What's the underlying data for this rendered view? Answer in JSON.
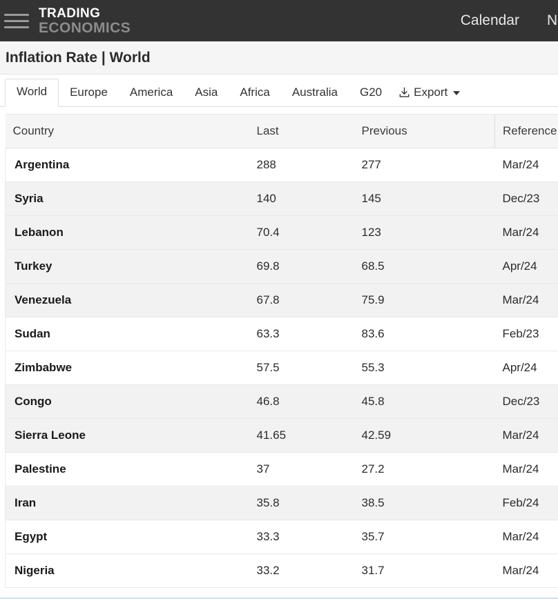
{
  "topbar": {
    "menu_icon": "hamburger-menu-icon",
    "brand_line1": "TRADING",
    "brand_line2": "ECONOMICS",
    "nav": [
      {
        "label": "Calendar"
      },
      {
        "label": "New"
      }
    ]
  },
  "page": {
    "title": "Inflation Rate | World"
  },
  "tabs": [
    {
      "label": "World",
      "active": true
    },
    {
      "label": "Europe",
      "active": false
    },
    {
      "label": "America",
      "active": false
    },
    {
      "label": "Asia",
      "active": false
    },
    {
      "label": "Africa",
      "active": false
    },
    {
      "label": "Australia",
      "active": false
    },
    {
      "label": "G20",
      "active": false
    }
  ],
  "export": {
    "label": "Export",
    "icon": "download-icon",
    "caret": "chevron-down-icon"
  },
  "table": {
    "columns": [
      "Country",
      "Last",
      "Previous",
      "Reference"
    ],
    "rows": [
      {
        "country": "Argentina",
        "last": "288",
        "previous": "277",
        "reference": "Mar/24",
        "shade": false
      },
      {
        "country": "Syria",
        "last": "140",
        "previous": "145",
        "reference": "Dec/23",
        "shade": true
      },
      {
        "country": "Lebanon",
        "last": "70.4",
        "previous": "123",
        "reference": "Mar/24",
        "shade": true
      },
      {
        "country": "Turkey",
        "last": "69.8",
        "previous": "68.5",
        "reference": "Apr/24",
        "shade": true
      },
      {
        "country": "Venezuela",
        "last": "67.8",
        "previous": "75.9",
        "reference": "Mar/24",
        "shade": true
      },
      {
        "country": "Sudan",
        "last": "63.3",
        "previous": "83.6",
        "reference": "Feb/23",
        "shade": false
      },
      {
        "country": "Zimbabwe",
        "last": "57.5",
        "previous": "55.3",
        "reference": "Apr/24",
        "shade": false
      },
      {
        "country": "Congo",
        "last": "46.8",
        "previous": "45.8",
        "reference": "Dec/23",
        "shade": true
      },
      {
        "country": "Sierra Leone",
        "last": "41.65",
        "previous": "42.59",
        "reference": "Mar/24",
        "shade": true
      },
      {
        "country": "Palestine",
        "last": "37",
        "previous": "27.2",
        "reference": "Mar/24",
        "shade": false
      },
      {
        "country": "Iran",
        "last": "35.8",
        "previous": "38.5",
        "reference": "Feb/24",
        "shade": true
      },
      {
        "country": "Egypt",
        "last": "33.3",
        "previous": "35.7",
        "reference": "Mar/24",
        "shade": false
      },
      {
        "country": "Nigeria",
        "last": "33.2",
        "previous": "31.7",
        "reference": "Mar/24",
        "shade": false
      }
    ]
  },
  "colors": {
    "topbar_bg": "#333333",
    "brand_primary": "#ffffff",
    "brand_secondary": "#8c8c8c",
    "title_bg": "#f5f5f5",
    "row_shade": "#f2f2f2",
    "row_plain": "#ffffff",
    "text": "#2b2b2b"
  }
}
